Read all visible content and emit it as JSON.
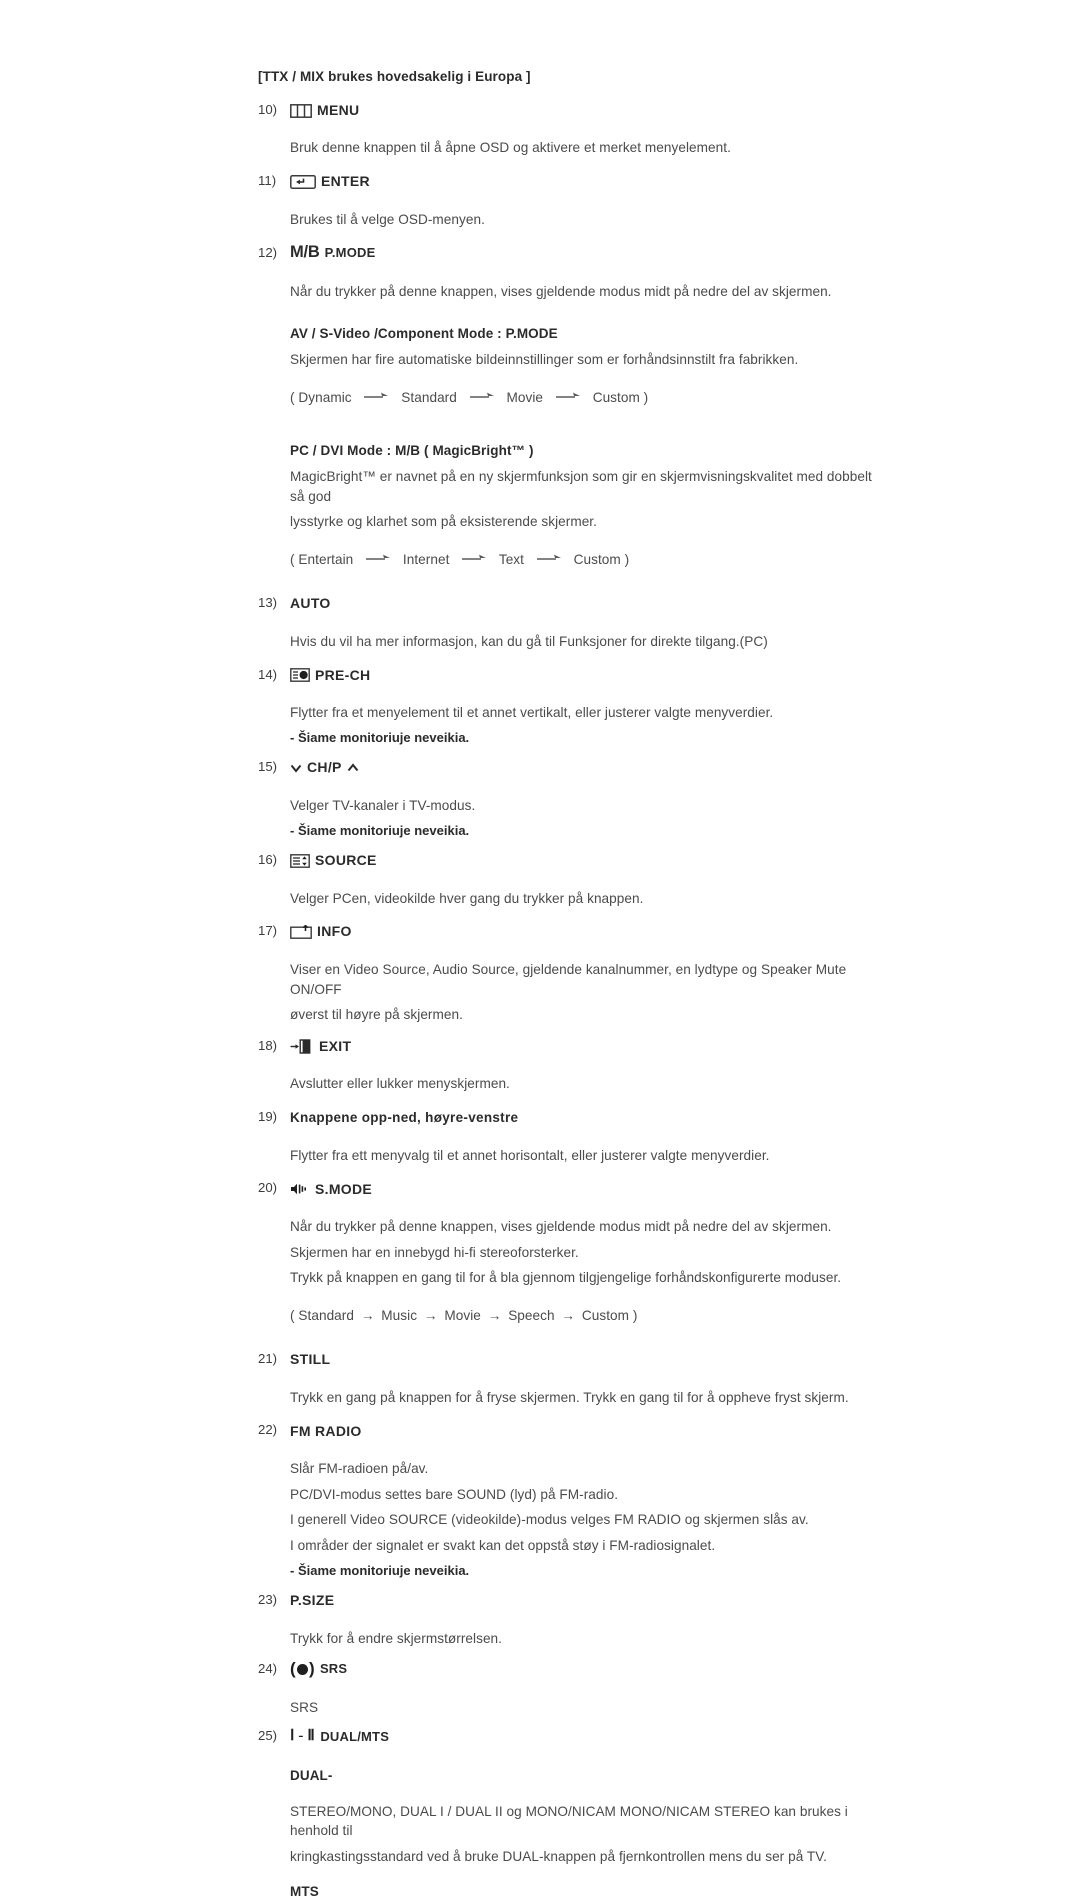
{
  "page": {
    "note_top": "[TTX / MIX brukes hovedsakelig i Europa ]",
    "repeat_note": "- Šiame monitoriuje neveikia."
  },
  "items": [
    {
      "num": "10)",
      "label": "MENU",
      "icon": "menu-bars-icon",
      "lines": [
        "Bruk denne knappen til å åpne OSD og aktivere et merket menyelement."
      ]
    },
    {
      "num": "11)",
      "label": "ENTER",
      "icon": "enter-return-icon",
      "lines": [
        "Brukes til å velge OSD-menyen."
      ]
    },
    {
      "num": "12)",
      "label": "P.MODE",
      "prefix": "M/B",
      "icon": "mb-text-icon",
      "lines": [
        "Når du trykker på denne knappen, vises gjeldende modus midt på nedre del av skjermen."
      ],
      "sub_sections": [
        {
          "heading": "AV / S-Video /Component Mode : P.MODE",
          "lines": [
            "Skjermen har fire automatiske bildeinnstillinger som er forhåndsinnstilt fra fabrikken."
          ],
          "sequence_open": "( Dynamic",
          "sequence_items": [
            "Standard",
            "Movie",
            "Custom )"
          ]
        },
        {
          "heading": "PC / DVI Mode : M/B ( MagicBright™ )",
          "lines": [
            "MagicBright™ er navnet på en ny skjermfunksjon som gir en skjermvisningskvalitet med dobbelt så god",
            "lysstyrke og klarhet som på eksisterende skjermer."
          ],
          "sequence_open": "( Entertain",
          "sequence_items": [
            "Internet",
            "Text",
            "Custom )"
          ]
        }
      ]
    },
    {
      "num": "13)",
      "label": "AUTO",
      "lines": [
        "Hvis du vil ha mer informasjon, kan du gå til Funksjoner for direkte tilgang.(PC)"
      ]
    },
    {
      "num": "14)",
      "label": "PRE-CH",
      "icon": "pre-ch-icon",
      "lines": [
        "Flytter fra et menyelement til et annet vertikalt, eller justerer valgte menyverdier."
      ],
      "note": "- Šiame monitoriuje neveikia."
    },
    {
      "num": "15)",
      "label": "CH/P",
      "icon": "chevron-down-up-icon",
      "lines": [
        "Velger TV-kanaler i TV-modus."
      ],
      "note": "- Šiame monitoriuje neveikia."
    },
    {
      "num": "16)",
      "label": "SOURCE",
      "icon": "source-list-icon",
      "lines": [
        "Velger PCen, videokilde hver gang du trykker på knappen."
      ]
    },
    {
      "num": "17)",
      "label": "INFO",
      "icon": "info-box-icon",
      "lines": [
        "Viser en Video Source, Audio Source, gjeldende kanalnummer, en lydtype og Speaker Mute ON/OFF",
        "øverst til høyre på skjermen."
      ]
    },
    {
      "num": "18)",
      "label": "EXIT",
      "icon": "exit-door-icon",
      "lines": [
        "Avslutter eller lukker menyskjermen."
      ]
    },
    {
      "num": "19)",
      "label": "Knappene opp-ned, høyre-venstre",
      "lines": [
        "Flytter fra ett menyvalg til et annet horisontalt, eller justerer valgte menyverdier."
      ]
    },
    {
      "num": "20)",
      "label": "S.MODE",
      "icon": "sound-mode-icon",
      "lines": [
        "Når du trykker på denne knappen, vises gjeldende modus midt på nedre del av skjermen.",
        "Skjermen har en innebygd hi-fi stereoforsterker.",
        "Trykk på knappen en gang til for å bla gjennom tilgjengelige forhåndskonfigurerte moduser."
      ],
      "sequence_open": "( Standard",
      "sequence_items": [
        "Music",
        "Movie",
        "Speech",
        "Custom )"
      ]
    },
    {
      "num": "21)",
      "label": "STILL",
      "lines": [
        "Trykk en gang på knappen for å fryse skjermen. Trykk en gang til for å oppheve fryst skjerm."
      ]
    },
    {
      "num": "22)",
      "label": "FM RADIO",
      "lines": [
        "Slår FM-radioen på/av.",
        "PC/DVI-modus settes bare SOUND (lyd) på FM-radio.",
        "I generell Video SOURCE (videokilde)-modus velges FM RADIO og skjermen slås av.",
        "I områder der signalet er svakt kan det oppstå støy i FM-radiosignalet."
      ],
      "note": "- Šiame monitoriuje neveikia."
    },
    {
      "num": "23)",
      "label": "P.SIZE",
      "lines": [
        "Trykk for å endre skjermstørrelsen."
      ]
    },
    {
      "num": "24)",
      "label": "SRS",
      "icon": "srs-icon",
      "lines": [
        "SRS"
      ]
    },
    {
      "num": "25)",
      "label": "DUAL/MTS",
      "icon": "dual-mts-icon",
      "sub_sections": [
        {
          "heading": "DUAL-",
          "lines": [
            "STEREO/MONO, DUAL I / DUAL II og MONO/NICAM MONO/NICAM STEREO kan brukes i henhold til",
            "kringkastingsstandard ved å bruke DUAL-knappen på fjernkontrollen mens du ser på TV."
          ]
        },
        {
          "heading": "MTS",
          "lines": []
        }
      ]
    }
  ]
}
